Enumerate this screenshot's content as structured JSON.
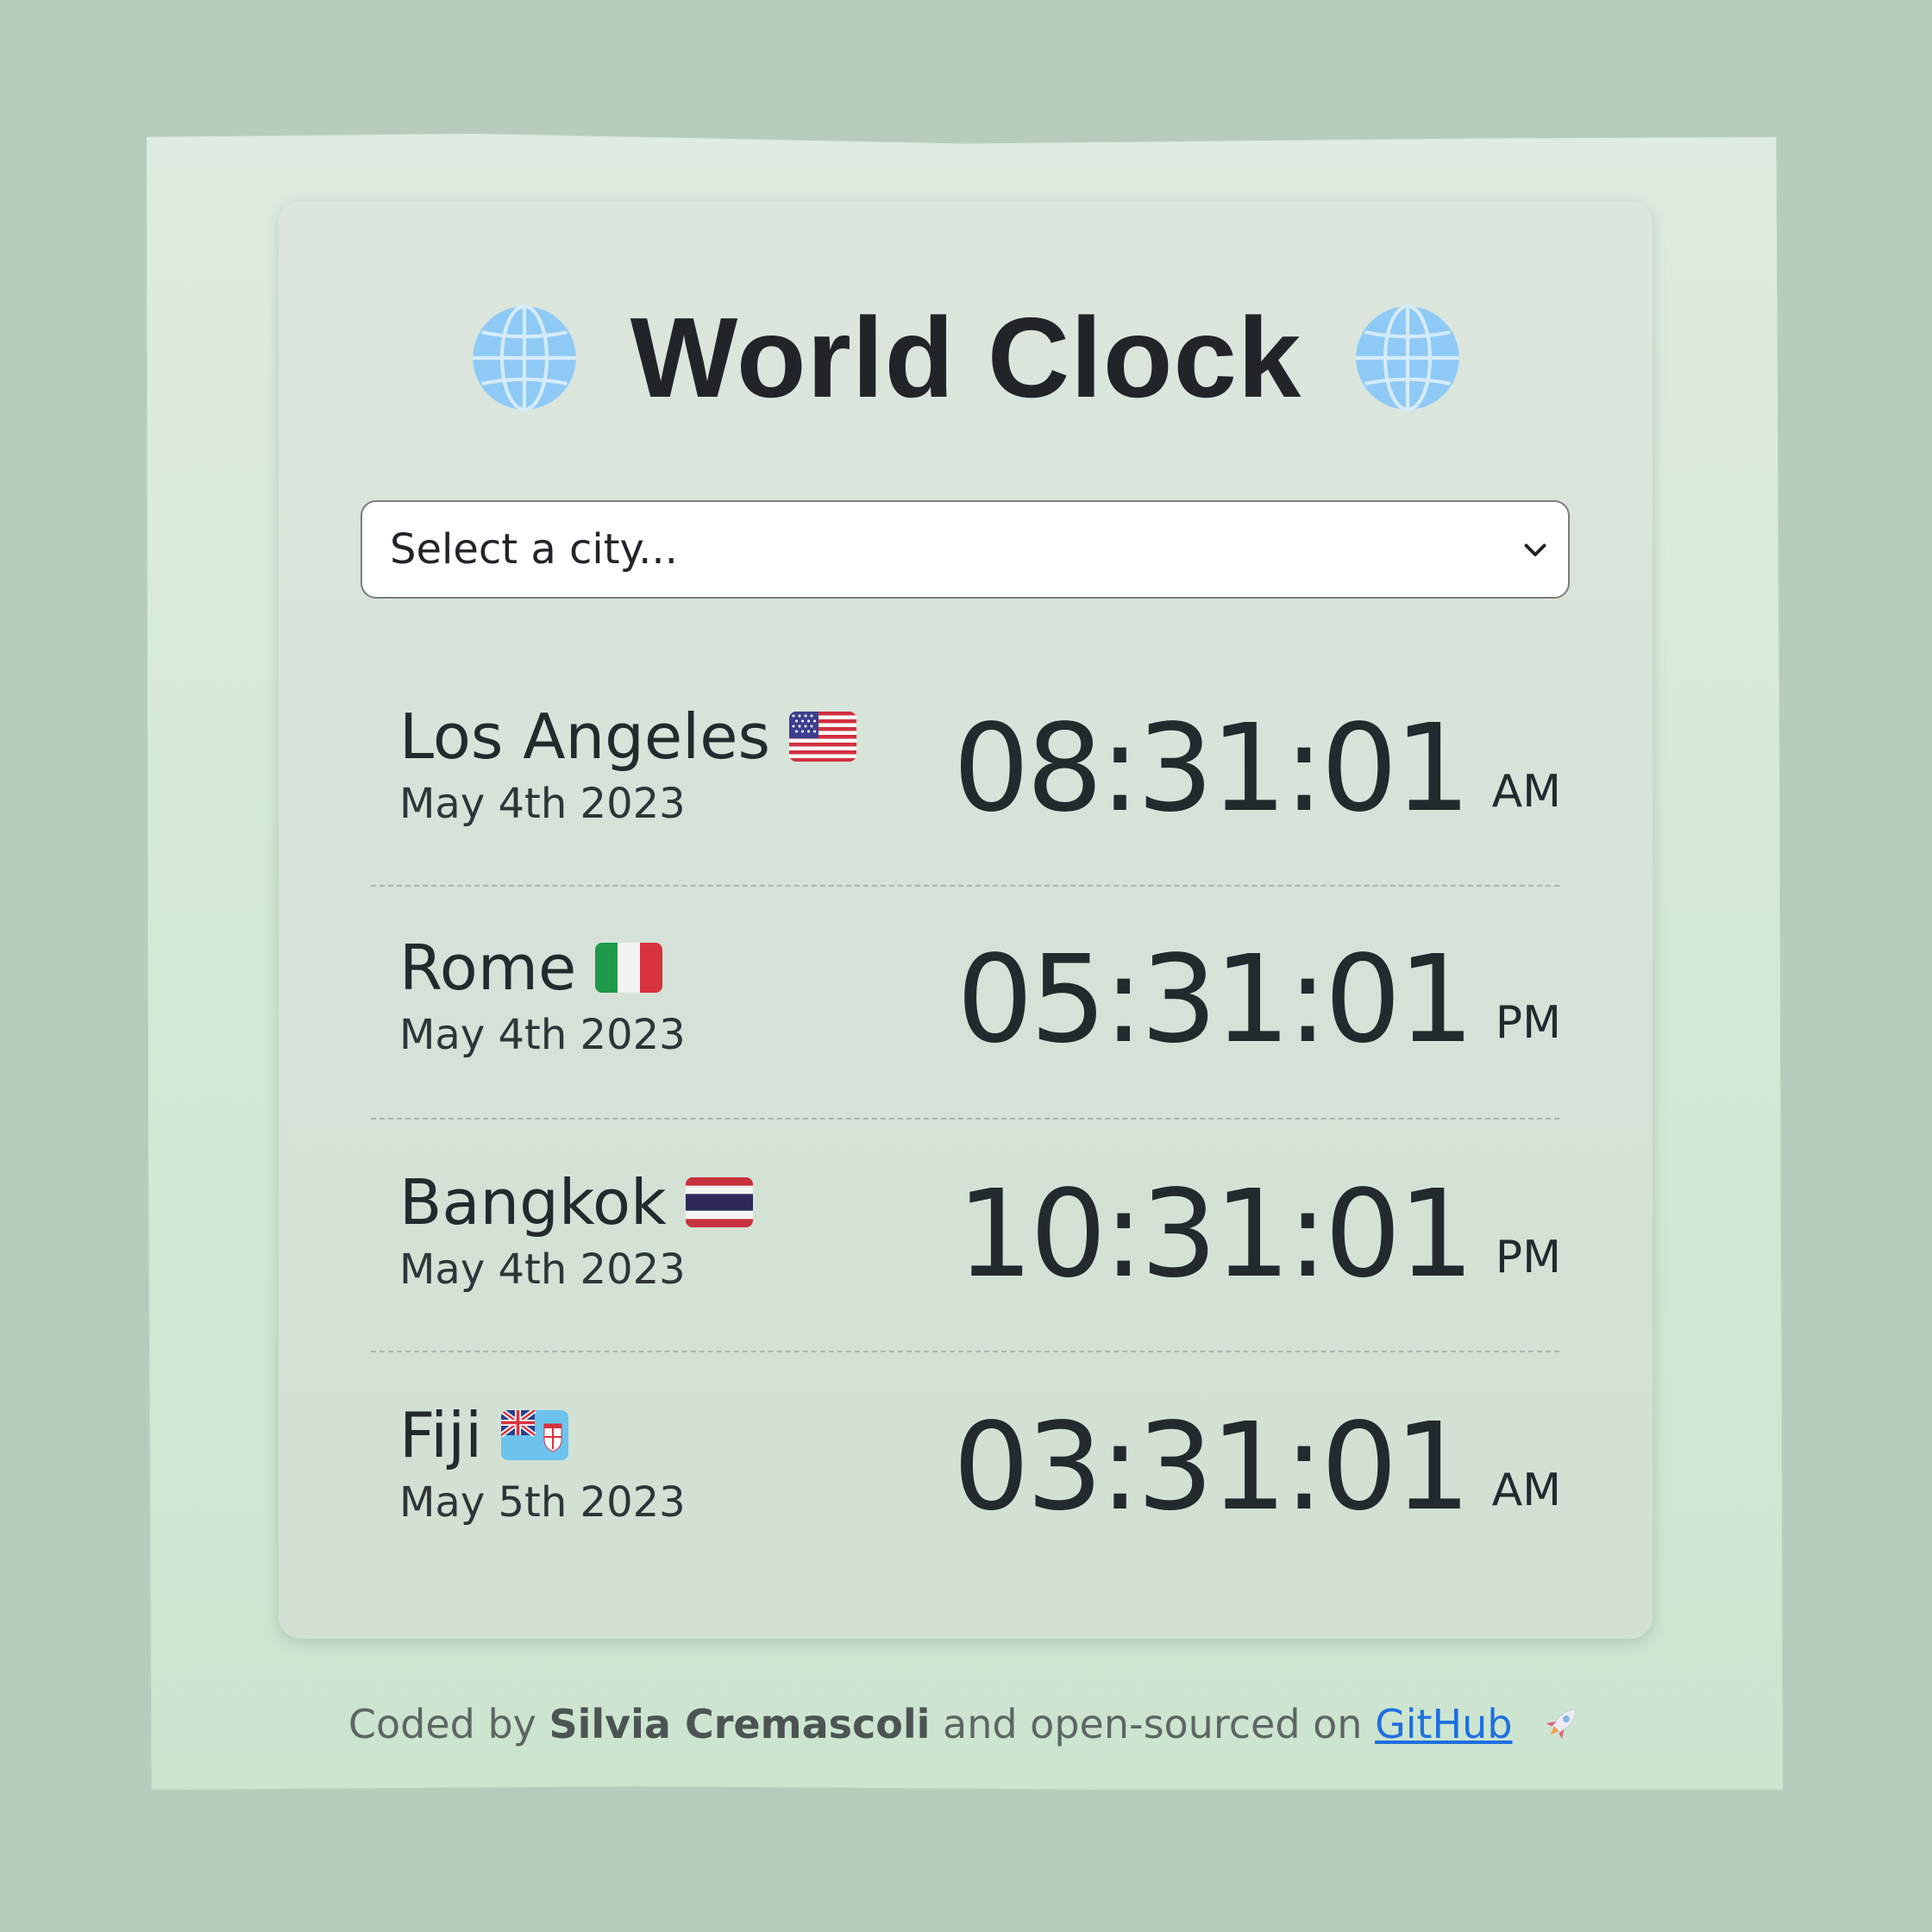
{
  "header": {
    "title": "World Clock",
    "left_icon": "globe-icon",
    "right_icon": "globe-icon"
  },
  "city_select": {
    "value": "Select a city...",
    "icon": "chevron-down-icon"
  },
  "cities": [
    {
      "name": "Los Angeles",
      "flag": "us-flag-icon",
      "date": "May 4th 2023",
      "time": "08:31:01",
      "ampm": "AM"
    },
    {
      "name": "Rome",
      "flag": "italy-flag-icon",
      "date": "May 4th 2023",
      "time": "05:31:01",
      "ampm": "PM"
    },
    {
      "name": "Bangkok",
      "flag": "thailand-flag-icon",
      "date": "May 4th 2023",
      "time": "10:31:01",
      "ampm": "PM"
    },
    {
      "name": "Fiji",
      "flag": "fiji-flag-icon",
      "date": "May 5th 2023",
      "time": "03:31:01",
      "ampm": "AM"
    }
  ],
  "footer": {
    "coded_by": "Coded by",
    "author": "Silvia Cremascoli",
    "middle": "and open-sourced on",
    "link": "GitHub",
    "icon": "rocket-icon"
  },
  "colors": {
    "background": "#b6cdbe",
    "card": "#d6e2d8",
    "link": "#1f6fe0",
    "text": "#222a2e"
  }
}
